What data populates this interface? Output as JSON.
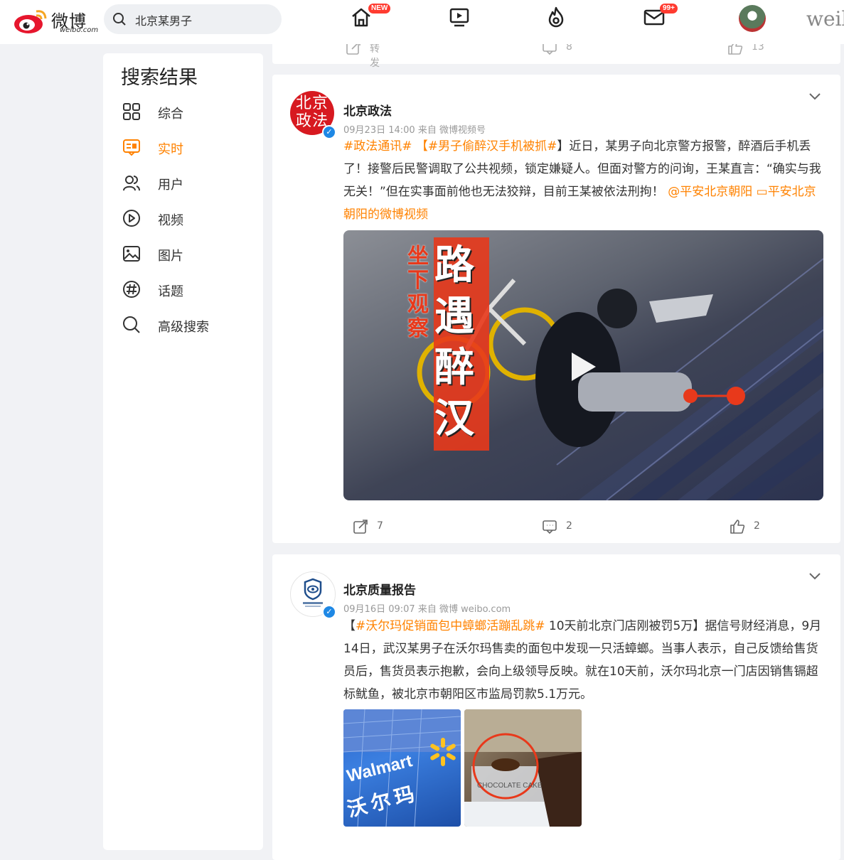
{
  "header": {
    "logo_text": "微博",
    "logo_sub": "weibo.com",
    "search_value": "北京某男子",
    "home_badge": "NEW",
    "mail_badge": "99+",
    "brand_right": "weil"
  },
  "sidebar": {
    "title": "搜索结果",
    "items": [
      {
        "label": "综合",
        "icon": "grid-icon"
      },
      {
        "label": "实时",
        "icon": "realtime-icon",
        "active": true
      },
      {
        "label": "用户",
        "icon": "users-icon"
      },
      {
        "label": "视频",
        "icon": "video-icon"
      },
      {
        "label": "图片",
        "icon": "image-icon"
      },
      {
        "label": "话题",
        "icon": "topic-icon"
      },
      {
        "label": "高级搜索",
        "icon": "search-icon"
      }
    ]
  },
  "prev_post": {
    "repost_label": "转发",
    "comment_count": "8",
    "like_count": "13"
  },
  "posts": [
    {
      "author": "北京政法",
      "avatar_text": "北京政法",
      "meta": "09月23日 14:00  来自 微博视频号",
      "tag1": "#政法通讯#",
      "tag2": "【#男子偷醉汉手机被抓#",
      "text1": "】近日，某男子向北京警方报警，醉酒后手机丢了！接警后民警调取了公共视频，锁定嫌疑人。但面对警方的问询，王某直言：“确实与我无关！”但在实事面前他也无法狡辩，目前王某被依法刑拘！",
      "mention": "@平安北京朝阳",
      "video_link": "平安北京朝阳的微博视频",
      "video_title_side": "坐下观察",
      "video_title_main": "路遇醉汉",
      "repost_count": "7",
      "comment_count": "2",
      "like_count": "2"
    },
    {
      "author": "北京质量报告",
      "meta": "09月16日 09:07  来自 微博 weibo.com",
      "bracket_open": "【",
      "tag": "#沃尔玛促销面包中蟑螂活蹦乱跳#",
      "text": " 10天前北京门店刚被罚5万】据信号财经消息，9月14日，武汉某男子在沃尔玛售卖的面包中发现一只活蟑螂。当事人表示，自己反馈给售货员后，售货员表示抱歉，会向上级领导反映。就在10天前，沃尔玛北京一门店因销售镉超标鱿鱼，被北京市朝阳区市监局罚款5.1万元。",
      "thumb1_text": "Walmart",
      "thumb1_cn": "沃尔玛",
      "thumb2_text": "CHOCOLATE CAKE"
    }
  ],
  "colors": {
    "accent": "#ff8200",
    "badge": "#ff3b30",
    "verified": "#1e88e5"
  }
}
